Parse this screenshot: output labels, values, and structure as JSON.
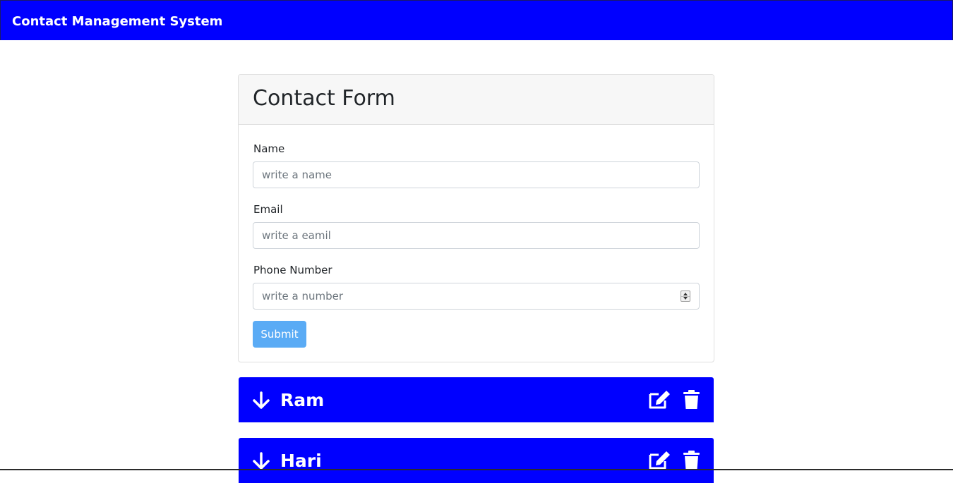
{
  "navbar": {
    "brand": "Contact Management System"
  },
  "form": {
    "title": "Contact Form",
    "fields": [
      {
        "label": "Name",
        "placeholder": "write a name",
        "type": "text",
        "value": ""
      },
      {
        "label": "Email",
        "placeholder": "write a eamil",
        "type": "text",
        "value": ""
      },
      {
        "label": "Phone Number",
        "placeholder": "write a number",
        "type": "number",
        "value": ""
      }
    ],
    "submit_label": "Submit"
  },
  "contacts": [
    {
      "name": "Ram",
      "icons": [
        "arrow-down-icon",
        "edit-icon",
        "trash-icon"
      ]
    },
    {
      "name": "Hari",
      "icons": [
        "arrow-down-icon",
        "edit-icon",
        "trash-icon"
      ]
    }
  ],
  "colors": {
    "navbar_bg": "#0000ff",
    "contact_bg": "#0000ff",
    "submit_bg": "#5aabf5",
    "card_header_bg": "#f7f7f7"
  }
}
